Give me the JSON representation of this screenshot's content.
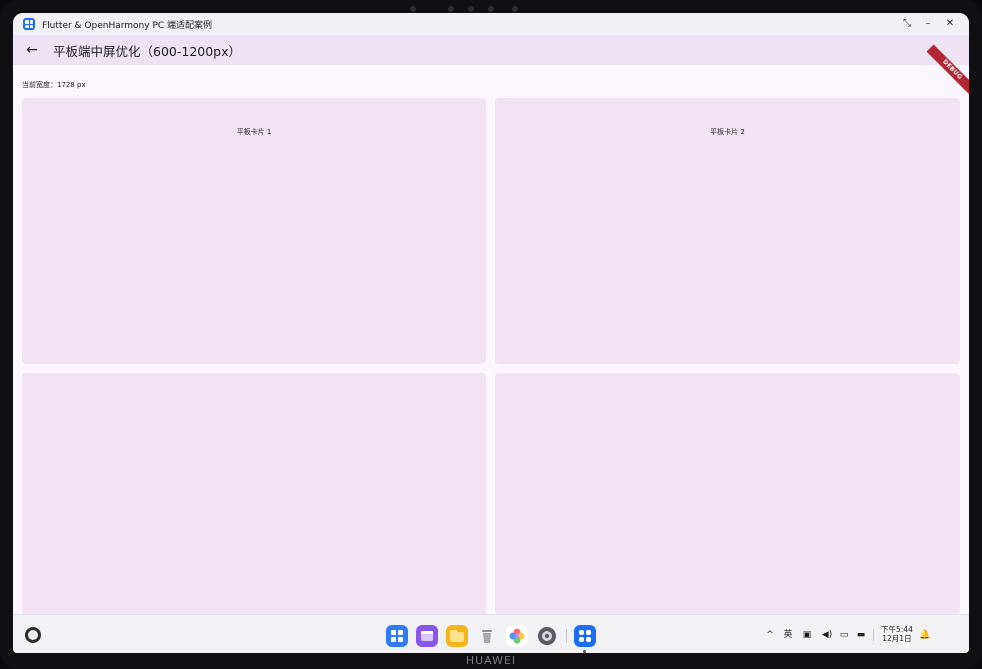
{
  "window": {
    "title": "Flutter & OpenHarmony PC 端适配案例",
    "controls": {
      "restore": "⤡",
      "minimize": "–",
      "close": "✕"
    }
  },
  "appbar": {
    "back_icon": "←",
    "title": "平板端中屏优化（600-1200px）",
    "debug_banner": "DEBUG"
  },
  "body": {
    "width_label": "当前宽度：1728 px",
    "cards": [
      {
        "label": "平板卡片 1"
      },
      {
        "label": "平板卡片 2"
      },
      {
        "label": ""
      },
      {
        "label": ""
      }
    ]
  },
  "taskbar": {
    "dock": [
      {
        "name": "app-center-icon",
        "color": "#2f7cf6"
      },
      {
        "name": "multi-window-icon",
        "color": "#8a56e8"
      },
      {
        "name": "files-icon",
        "color": "#f4b41a"
      },
      {
        "name": "trash-icon",
        "color": "#9a9aa2"
      },
      {
        "name": "photos-icon",
        "color": "#ff6b6b"
      },
      {
        "name": "settings-icon",
        "color": "#5b5b66"
      },
      {
        "name": "flutter-app-icon",
        "color": "#1e6ef5"
      }
    ],
    "tray": {
      "chevron": "^",
      "ime": "英",
      "clipboard": "▣",
      "volume": "◀)",
      "display": "▭",
      "battery": "▬"
    },
    "clock": {
      "time": "下午5:44",
      "date": "12月1日"
    },
    "bell": "🔔"
  },
  "device": {
    "brand": "HUAWEI"
  }
}
